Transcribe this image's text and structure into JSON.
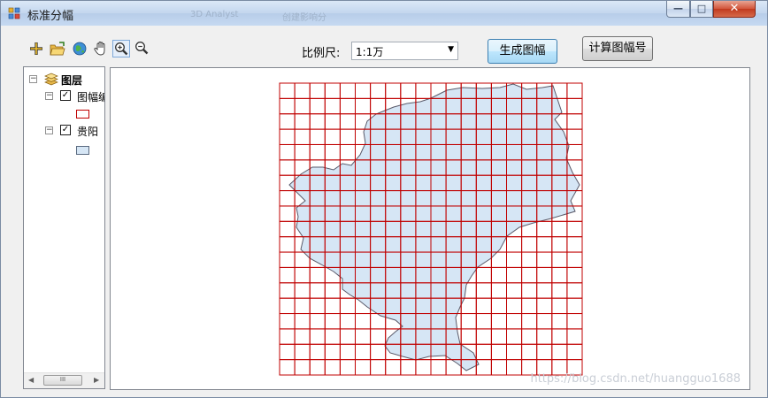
{
  "window": {
    "title": "标准分幅",
    "ghost_texts": [
      "3D Analyst",
      "创建影响分"
    ],
    "controls": {
      "minimize": "—",
      "maximize": "□",
      "close": "✕"
    }
  },
  "toolbar": {
    "tools": [
      {
        "name": "add-data-icon",
        "glyph": "✚"
      },
      {
        "name": "open-folder-icon",
        "glyph": "📂"
      },
      {
        "name": "full-extent-globe-icon",
        "glyph": "🌐"
      },
      {
        "name": "pan-hand-icon",
        "glyph": "✋"
      },
      {
        "name": "zoom-in-icon",
        "glyph": "🔍"
      },
      {
        "name": "zoom-out-icon",
        "glyph": "🔍"
      }
    ],
    "scale_label": "比例尺:",
    "scale_value": "1:1万",
    "generate_button": "生成图幅",
    "compute_button": "计算图幅号"
  },
  "toc": {
    "root_label": "图层",
    "layers": [
      {
        "label": "图幅编",
        "checked": true,
        "symbol": "outline-red"
      },
      {
        "label": "贵阳",
        "checked": true,
        "symbol": "fill-lightblue"
      }
    ],
    "scroll_thumb": "III"
  },
  "map": {
    "grid_rows": 19,
    "grid_cols": 20,
    "grid_color": "#c00000",
    "fill_color": "#d6e6f5",
    "outline_color": "#5a5a6a"
  },
  "watermark": "https://blog.csdn.net/huangguo1688"
}
